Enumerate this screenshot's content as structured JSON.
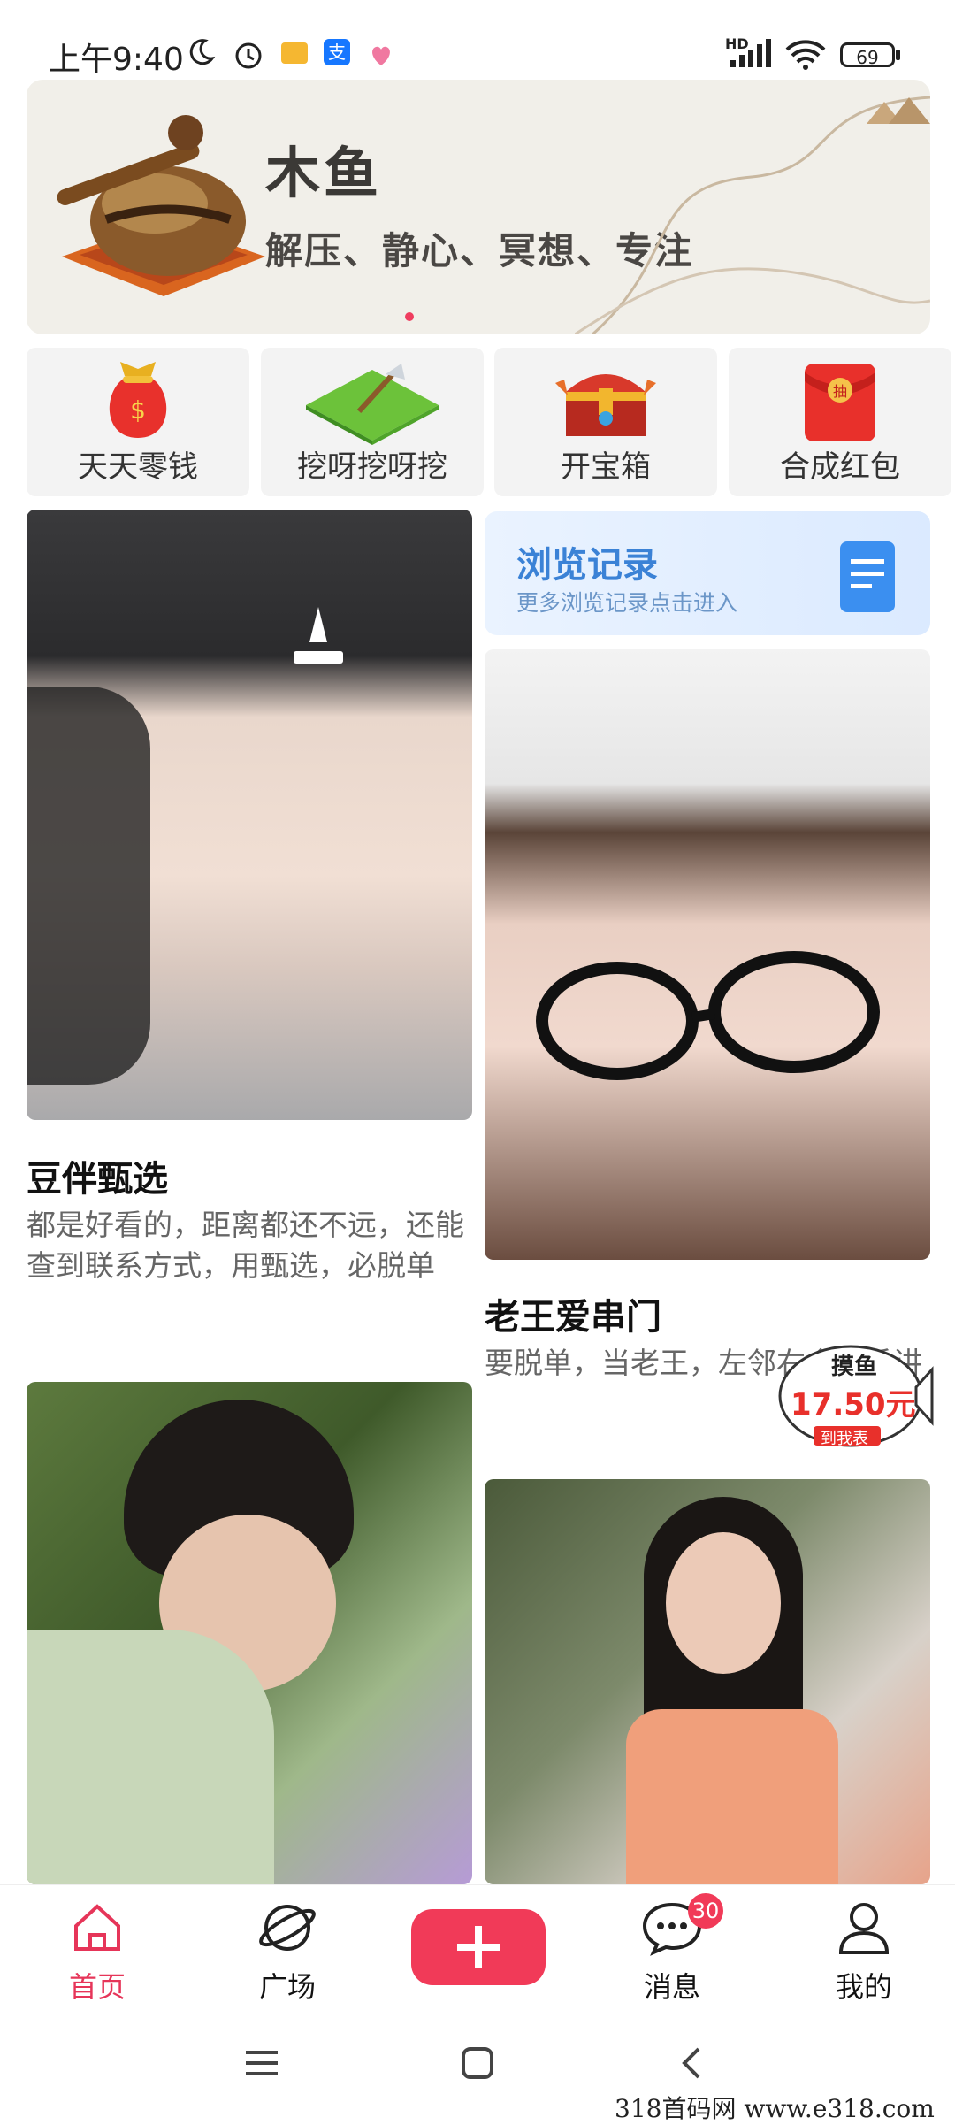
{
  "status_bar": {
    "time": "上午9:40",
    "battery": "69",
    "network": "HD"
  },
  "banner": {
    "title": "木鱼",
    "subtitle": "解压、静心、冥想、专注"
  },
  "quick_actions": [
    {
      "label": "天天零钱",
      "icon": "money-bag-icon"
    },
    {
      "label": "挖呀挖呀挖",
      "icon": "shovel-grass-icon"
    },
    {
      "label": "开宝箱",
      "icon": "treasure-chest-icon"
    },
    {
      "label": "合成红包",
      "icon": "red-envelope-icon"
    }
  ],
  "history": {
    "title": "浏览记录",
    "subtitle": "更多浏览记录点击进入"
  },
  "feed": {
    "left": [
      {
        "title": "豆伴甄选",
        "desc": "都是好看的，距离都还不远，还能查到联系方式，用甄选，必脱单"
      }
    ],
    "right": [
      {
        "title": "老王爱串门",
        "desc": "要脱单，当老王，左邻右舍都手讲"
      }
    ]
  },
  "float_badge": {
    "top": "摸鱼",
    "amount": "17.50元",
    "bottom": "到我表"
  },
  "tabbar": {
    "home": "首页",
    "square": "广场",
    "messages": "消息",
    "messages_count": "30",
    "mine": "我的"
  },
  "watermark": "318首码网   www.e318.com",
  "colors": {
    "accent": "#f13a58",
    "history_blue": "#3b82d6"
  }
}
